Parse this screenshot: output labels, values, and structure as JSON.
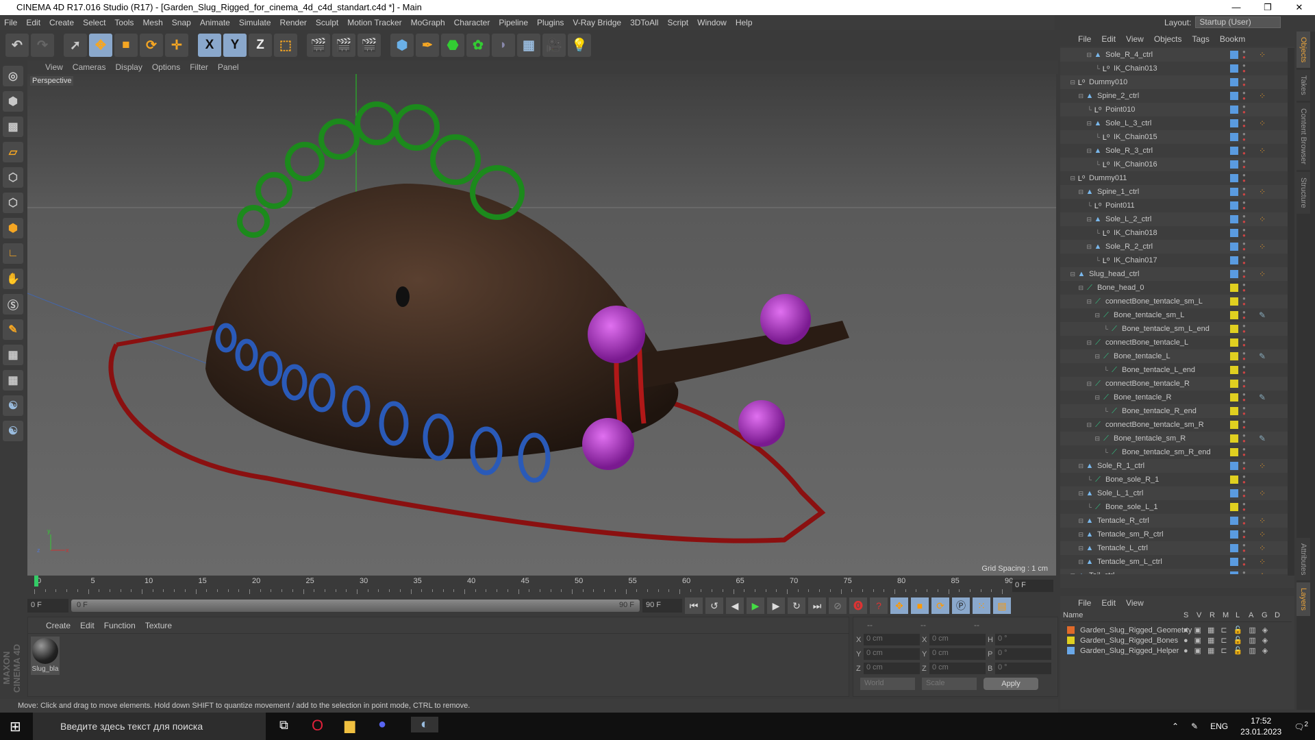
{
  "title": "CINEMA 4D R17.016 Studio (R17) - [Garden_Slug_Rigged_for_cinema_4d_c4d_standart.c4d *] - Main",
  "menu": [
    "File",
    "Edit",
    "Create",
    "Select",
    "Tools",
    "Mesh",
    "Snap",
    "Animate",
    "Simulate",
    "Render",
    "Sculpt",
    "Motion Tracker",
    "MoGraph",
    "Character",
    "Pipeline",
    "Plugins",
    "V-Ray Bridge",
    "3DToAll",
    "Script",
    "Window",
    "Help"
  ],
  "layout": {
    "label": "Layout:",
    "value": "Startup (User)"
  },
  "toolbar": {
    "x": "X",
    "y": "Y",
    "z": "Z"
  },
  "viewport": {
    "menu": [
      "View",
      "Cameras",
      "Display",
      "Options",
      "Filter",
      "Panel"
    ],
    "label": "Perspective",
    "grid": "Grid Spacing : 1 cm"
  },
  "timeline": {
    "ticks": [
      "0",
      "5",
      "10",
      "15",
      "20",
      "25",
      "30",
      "35",
      "40",
      "45",
      "50",
      "55",
      "60",
      "65",
      "70",
      "75",
      "80",
      "85",
      "90"
    ],
    "current": "0 F",
    "start": "0 F",
    "range_start": "0 F",
    "range_end": "90 F",
    "end": "90 F"
  },
  "materials": {
    "menu": [
      "Create",
      "Edit",
      "Function",
      "Texture"
    ],
    "items": [
      "Slug_bla"
    ]
  },
  "coords": {
    "head": [
      "--",
      "--",
      "--"
    ],
    "rows": [
      [
        "X",
        "0 cm",
        "X",
        "0 cm",
        "H",
        "0 °"
      ],
      [
        "Y",
        "0 cm",
        "Y",
        "0 cm",
        "P",
        "0 °"
      ],
      [
        "Z",
        "0 cm",
        "Z",
        "0 cm",
        "B",
        "0 °"
      ]
    ],
    "world": "World",
    "scale": "Scale",
    "apply": "Apply"
  },
  "status": "Move: Click and drag to move elements. Hold down SHIFT to quantize movement / add to the selection in point mode, CTRL to remove.",
  "brand": "MAXON CINEMA 4D",
  "objects": {
    "menu": [
      "File",
      "Edit",
      "View",
      "Objects",
      "Tags",
      "Bookm"
    ],
    "rows": [
      [
        "Sole_R_4_ctrl",
        3,
        "ctrl",
        "#5a9be0",
        true
      ],
      [
        "IK_Chain013",
        4,
        "null",
        "#5a9be0",
        false
      ],
      [
        "Dummy010",
        1,
        "null",
        "#5a9be0",
        false
      ],
      [
        "Spine_2_ctrl",
        2,
        "ctrl",
        "#5a9be0",
        true
      ],
      [
        "Point010",
        3,
        "null",
        "#5a9be0",
        false
      ],
      [
        "Sole_L_3_ctrl",
        3,
        "ctrl",
        "#5a9be0",
        true
      ],
      [
        "IK_Chain015",
        4,
        "null",
        "#5a9be0",
        false
      ],
      [
        "Sole_R_3_ctrl",
        3,
        "ctrl",
        "#5a9be0",
        true
      ],
      [
        "IK_Chain016",
        4,
        "null",
        "#5a9be0",
        false
      ],
      [
        "Dummy011",
        1,
        "null",
        "#5a9be0",
        false
      ],
      [
        "Spine_1_ctrl",
        2,
        "ctrl",
        "#5a9be0",
        true
      ],
      [
        "Point011",
        3,
        "null",
        "#5a9be0",
        false
      ],
      [
        "Sole_L_2_ctrl",
        3,
        "ctrl",
        "#5a9be0",
        true
      ],
      [
        "IK_Chain018",
        4,
        "null",
        "#5a9be0",
        false
      ],
      [
        "Sole_R_2_ctrl",
        3,
        "ctrl",
        "#5a9be0",
        true
      ],
      [
        "IK_Chain017",
        4,
        "null",
        "#5a9be0",
        false
      ],
      [
        "Slug_head_ctrl",
        1,
        "ctrl",
        "#5a9be0",
        true
      ],
      [
        "Bone_head_0",
        2,
        "bone",
        "#e0d020",
        false
      ],
      [
        "connectBone_tentacle_sm_L",
        3,
        "bone",
        "#e0d020",
        false
      ],
      [
        "Bone_tentacle_sm_L",
        4,
        "bone",
        "#e0d020",
        "ik"
      ],
      [
        "Bone_tentacle_sm_L_end",
        5,
        "bone",
        "#e0d020",
        false
      ],
      [
        "connectBone_tentacle_L",
        3,
        "bone",
        "#e0d020",
        false
      ],
      [
        "Bone_tentacle_L",
        4,
        "bone",
        "#e0d020",
        "ik"
      ],
      [
        "Bone_tentacle_L_end",
        5,
        "bone",
        "#e0d020",
        false
      ],
      [
        "connectBone_tentacle_R",
        3,
        "bone",
        "#e0d020",
        false
      ],
      [
        "Bone_tentacle_R",
        4,
        "bone",
        "#e0d020",
        "ik"
      ],
      [
        "Bone_tentacle_R_end",
        5,
        "bone",
        "#e0d020",
        false
      ],
      [
        "connectBone_tentacle_sm_R",
        3,
        "bone",
        "#e0d020",
        false
      ],
      [
        "Bone_tentacle_sm_R",
        4,
        "bone",
        "#e0d020",
        "ik"
      ],
      [
        "Bone_tentacle_sm_R_end",
        5,
        "bone",
        "#e0d020",
        false
      ],
      [
        "Sole_R_1_ctrl",
        2,
        "ctrl",
        "#5a9be0",
        true
      ],
      [
        "Bone_sole_R_1",
        3,
        "bone",
        "#e0d020",
        false
      ],
      [
        "Sole_L_1_ctrl",
        2,
        "ctrl",
        "#5a9be0",
        true
      ],
      [
        "Bone_sole_L_1",
        3,
        "bone",
        "#e0d020",
        false
      ],
      [
        "Tentacle_R_ctrl",
        2,
        "ctrl",
        "#5a9be0",
        true
      ],
      [
        "Tentacle_sm_R_ctrl",
        2,
        "ctrl",
        "#5a9be0",
        true
      ],
      [
        "Tentacle_L_ctrl",
        2,
        "ctrl",
        "#5a9be0",
        true
      ],
      [
        "Tentacle_sm_L_ctrl",
        2,
        "ctrl",
        "#5a9be0",
        true
      ],
      [
        "Tail_ctrl",
        1,
        "ctrl",
        "#5a9be0",
        true
      ]
    ]
  },
  "layers": {
    "menu": [
      "File",
      "Edit",
      "View"
    ],
    "columns": [
      "Name",
      "S",
      "V",
      "R",
      "M",
      "L",
      "A",
      "G",
      "D"
    ],
    "rows": [
      {
        "name": "Garden_Slug_Rigged_Geometrty",
        "color": "#e06a2a"
      },
      {
        "name": "Garden_Slug_Rigged_Bones",
        "color": "#e0d020"
      },
      {
        "name": "Garden_Slug_Rigged_Helper",
        "color": "#6aa8e8"
      }
    ]
  },
  "right_tabs": [
    "Objects",
    "Takes",
    "Content Browser",
    "Structure"
  ],
  "right_tabs_bottom": [
    "Attributes",
    "Layers"
  ],
  "taskbar": {
    "search": "Введите здесь текст для поиска",
    "lang": "ENG",
    "time": "17:52",
    "date": "23.01.2023",
    "notifications": "2"
  }
}
